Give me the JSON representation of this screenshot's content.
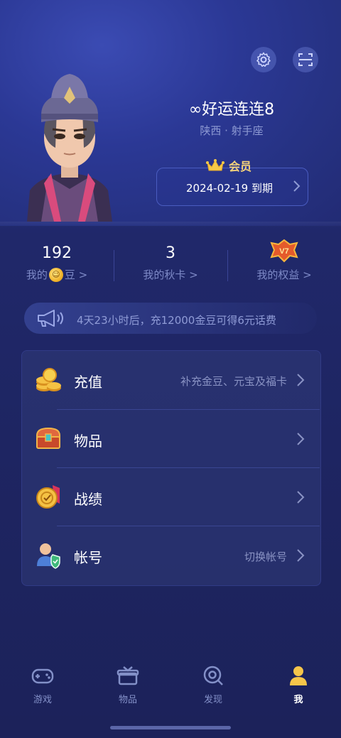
{
  "header": {
    "settings_icon": "gear-icon",
    "scan_icon": "scan-icon"
  },
  "profile": {
    "username": "∞好运连连8",
    "location": "陕西 · 射手座",
    "vip_label": "会员",
    "vip_expiry": "2024-02-19 到期"
  },
  "stats": [
    {
      "value": "192",
      "label_prefix": "我的",
      "label_suffix": "豆 >"
    },
    {
      "value": "3",
      "label": "我的秋卡 >"
    },
    {
      "label": "我的权益 >",
      "badge": "V7"
    }
  ],
  "notice": {
    "text": "4天23小时后，充12000金豆可得6元话费"
  },
  "menu": [
    {
      "label": "充值",
      "sub": "补充金豆、元宝及福卡",
      "icon": "coins-icon"
    },
    {
      "label": "物品",
      "sub": "",
      "icon": "treasure-chest-icon"
    },
    {
      "label": "战绩",
      "sub": "",
      "icon": "medal-icon"
    },
    {
      "label": "帐号",
      "sub": "切换帐号",
      "icon": "user-shield-icon"
    }
  ],
  "tabs": [
    {
      "label": "游戏",
      "icon": "gamepad-icon",
      "active": false
    },
    {
      "label": "物品",
      "icon": "gift-box-icon",
      "active": false
    },
    {
      "label": "发现",
      "icon": "discover-icon",
      "active": false
    },
    {
      "label": "我",
      "icon": "person-icon",
      "active": true
    }
  ],
  "colors": {
    "background": "#1e2562",
    "accent_gold": "#f6d37a",
    "muted_text": "#8e9ad3"
  }
}
